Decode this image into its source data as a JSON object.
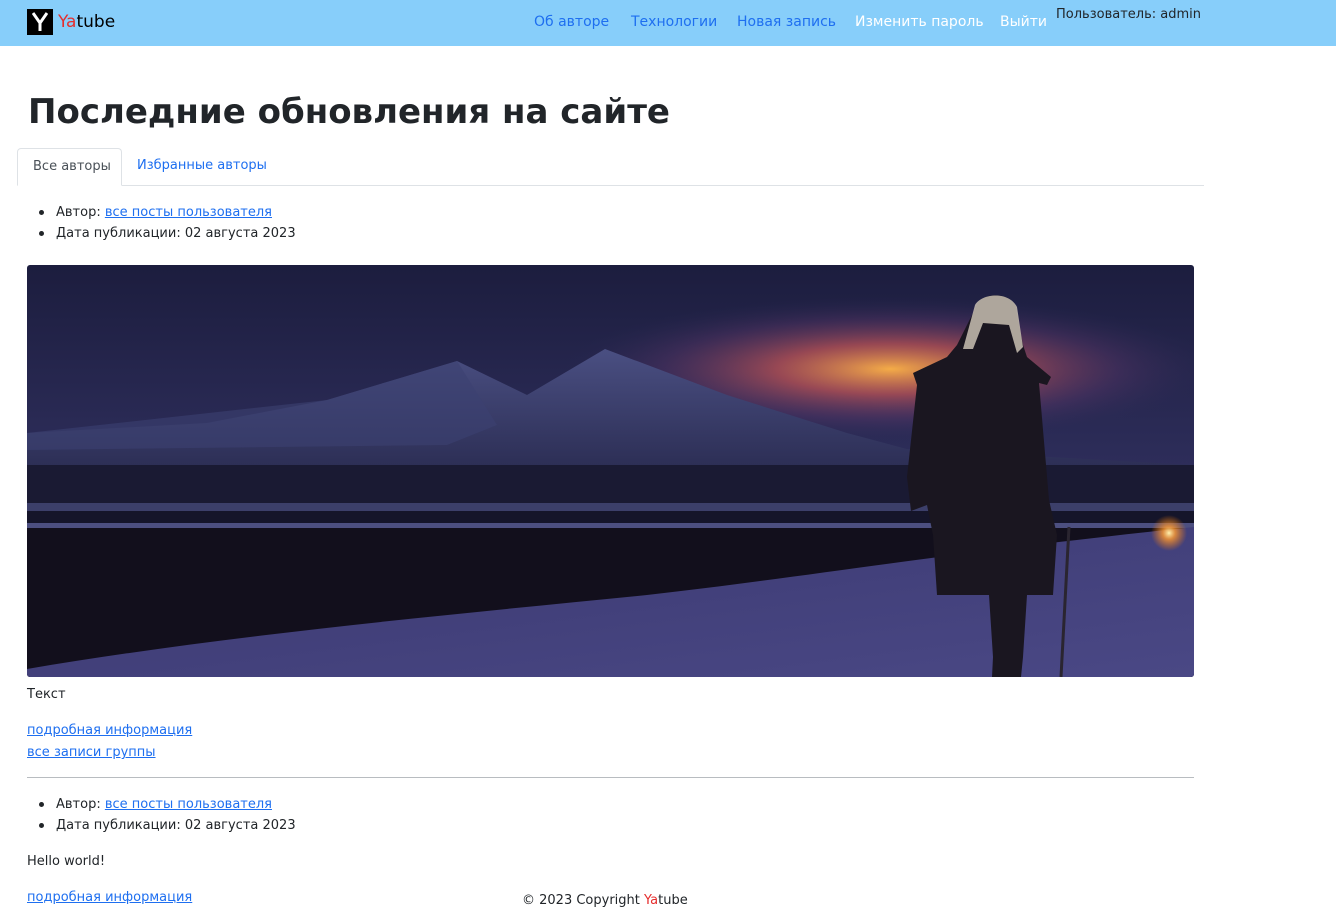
{
  "header": {
    "brand_ya": "Ya",
    "brand_rest": "tube",
    "nav": [
      {
        "label": "Об авторе"
      },
      {
        "label": "Технологии"
      },
      {
        "label": "Новая запись"
      },
      {
        "label": "Изменить пароль"
      },
      {
        "label": "Выйти"
      }
    ],
    "user_label": "Пользователь: admin"
  },
  "main": {
    "title": "Последние обновления на сайте",
    "tabs": [
      {
        "label": "Все авторы",
        "active": true
      },
      {
        "label": "Избранные авторы",
        "active": false
      }
    ],
    "posts": [
      {
        "author_label": "Автор:",
        "author_link": "все посты пользователя",
        "date_label": "Дата публикации:",
        "date_value": "02 августа 2023",
        "text": "Текст",
        "details_link": "подробная информация",
        "group_link": "все записи группы"
      },
      {
        "author_label": "Автор:",
        "author_link": "все посты пользователя",
        "date_label": "Дата публикации:",
        "date_value": "02 августа 2023",
        "text": "Hello world!",
        "details_link": "подробная информация"
      }
    ]
  },
  "footer": {
    "prefix": "© 2023 Copyright",
    "brand_ya": "Ya",
    "brand_rest": "tube"
  },
  "colors": {
    "navbar": "#87cefa",
    "link": "#1e6ff0",
    "brand_accent": "#e52e2e"
  }
}
